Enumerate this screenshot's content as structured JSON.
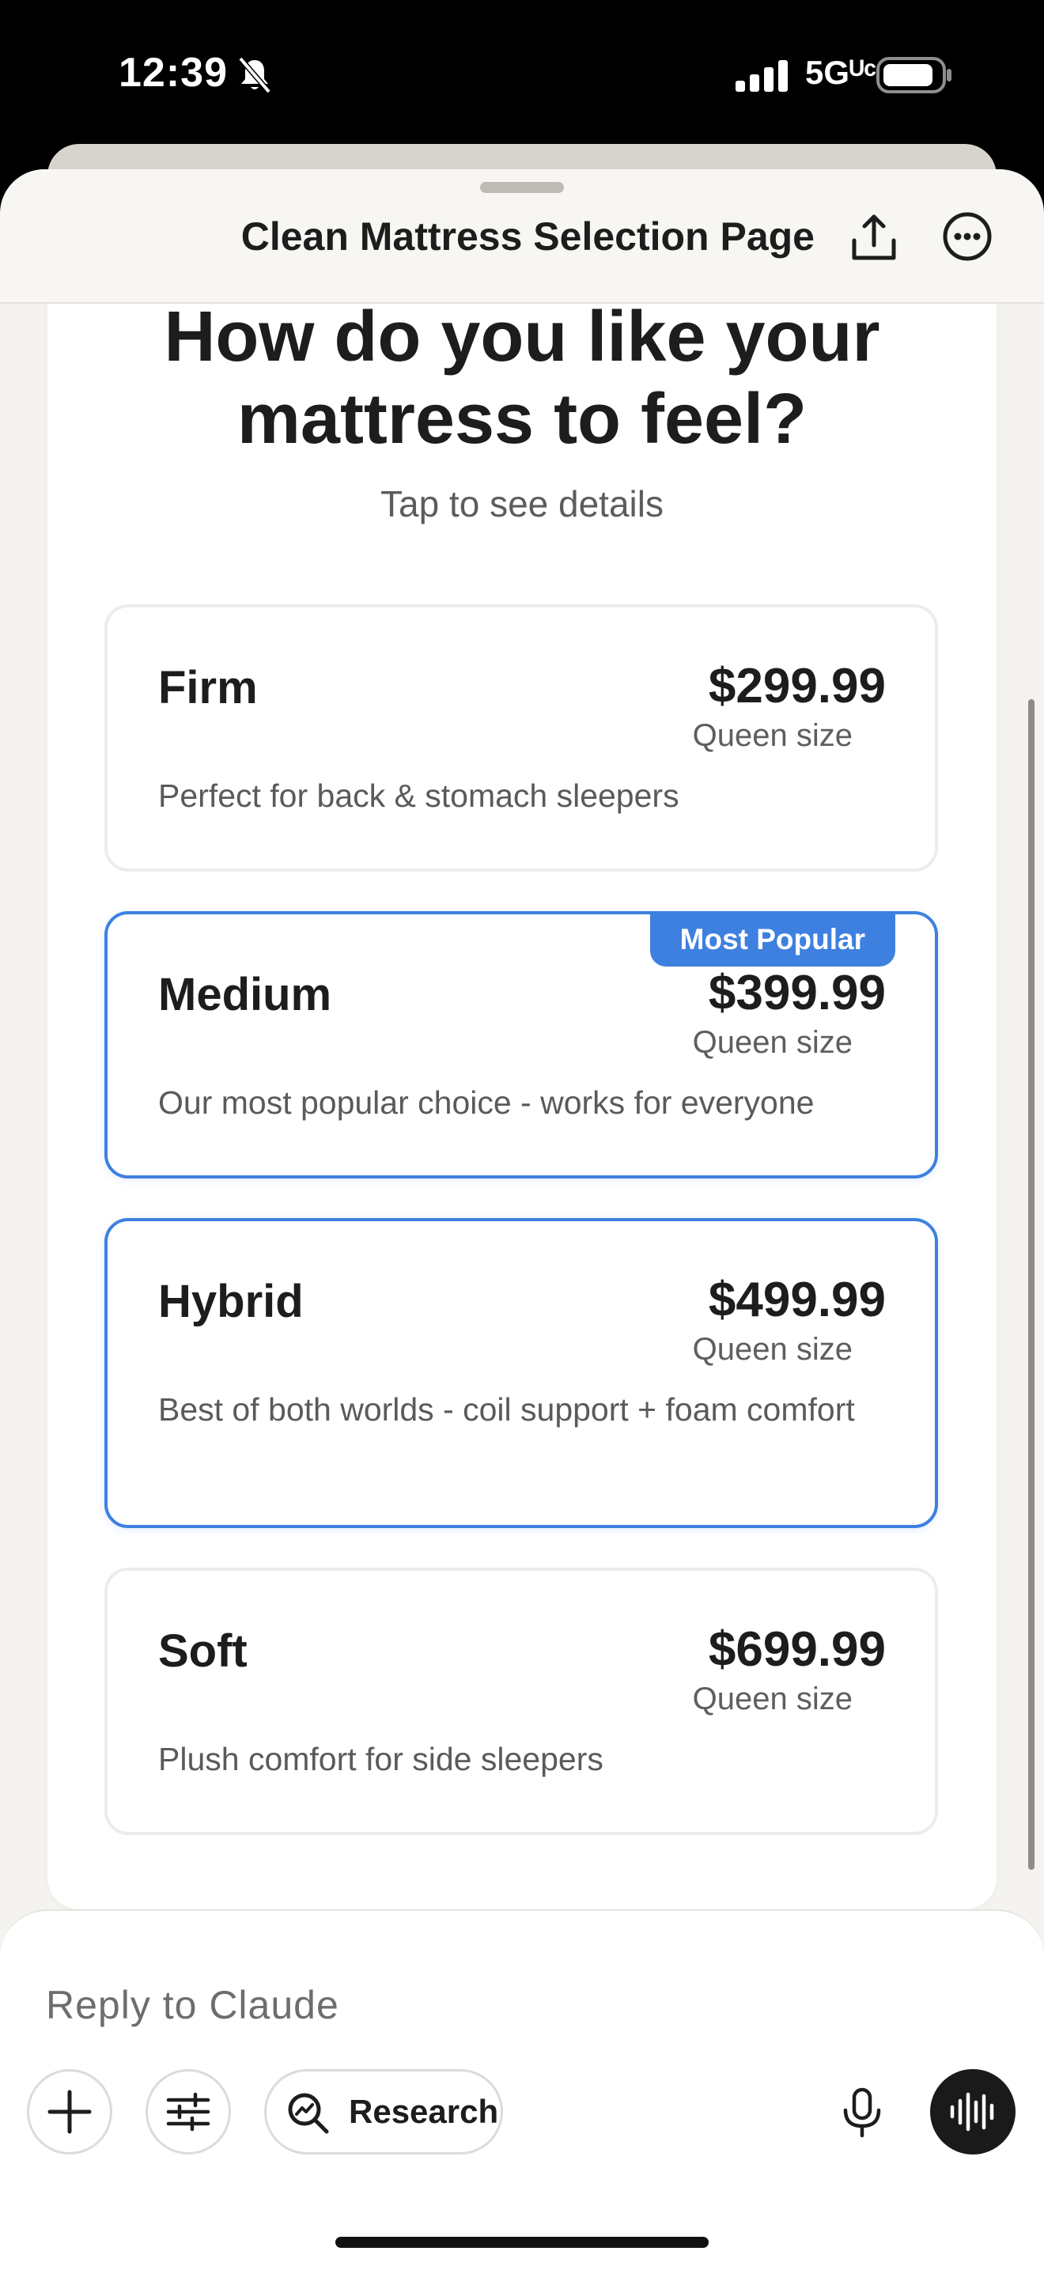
{
  "status_bar": {
    "time": "12:39",
    "network": "5Gᵁᶜ"
  },
  "header": {
    "title": "Clean Mattress Selection Page"
  },
  "main": {
    "question": "How do you like your mattress to feel?",
    "subtitle": "Tap to see details",
    "options": [
      {
        "name": "Firm",
        "price": "$299.99",
        "size": "Queen size",
        "description": "Perfect for back & stomach sleepers",
        "selected": false
      },
      {
        "name": "Medium",
        "price": "$399.99",
        "size": "Queen size",
        "description": "Our most popular choice - works for everyone",
        "selected": true,
        "badge": "Most Popular"
      },
      {
        "name": "Hybrid",
        "price": "$499.99",
        "size": "Queen size",
        "description": "Best of both worlds - coil support + foam comfort",
        "selected": true
      },
      {
        "name": "Soft",
        "price": "$699.99",
        "size": "Queen size",
        "description": "Plush comfort for side sleepers",
        "selected": false
      }
    ]
  },
  "composer": {
    "placeholder": "Reply to Claude",
    "research_label": "Research"
  },
  "colors": {
    "accent": "#3d80e0",
    "background": "#f4f3ef"
  }
}
